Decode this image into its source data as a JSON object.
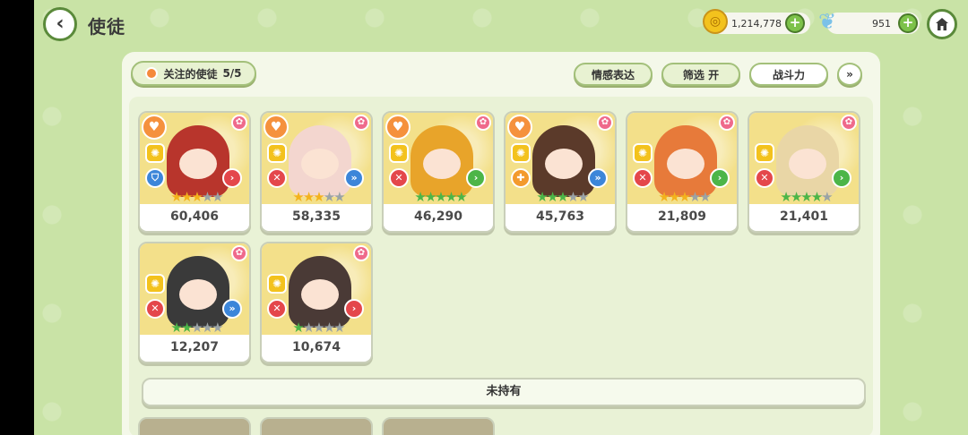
{
  "header": {
    "title": "使徒",
    "coins": "1,214,778",
    "gems": "951"
  },
  "toolbar": {
    "favorite_label": "关注的使徒",
    "favorite_count": "5/5",
    "emotion_label": "情感表达",
    "filter_label": "筛选 开",
    "power_label": "战斗力"
  },
  "cards": [
    {
      "power": "60,406",
      "favorite": true,
      "stars_filled": 3,
      "stars_total": 5,
      "star_color": "gold",
      "role": "blue",
      "arrow": "red",
      "hair": "#b8352c",
      "char": "red-haired demon girl"
    },
    {
      "power": "58,335",
      "favorite": true,
      "stars_filled": 3,
      "stars_total": 5,
      "star_color": "gold",
      "role": "red",
      "arrow": "blue",
      "hair": "#f3d6cf",
      "char": "pink-haired horned girl"
    },
    {
      "power": "46,290",
      "favorite": true,
      "stars_filled": 5,
      "stars_total": 5,
      "star_color": "green",
      "role": "red",
      "arrow": "green",
      "hair": "#e8a42a",
      "char": "bee"
    },
    {
      "power": "45,763",
      "favorite": true,
      "stars_filled": 3,
      "stars_total": 5,
      "star_color": "green",
      "role": "orange",
      "arrow": "blue",
      "hair": "#5b3a2a",
      "char": "brown-haired girl"
    },
    {
      "power": "21,809",
      "favorite": false,
      "stars_filled": 3,
      "stars_total": 5,
      "star_color": "gold",
      "role": "red",
      "arrow": "green",
      "hair": "#e77a3a",
      "char": "fox girl"
    },
    {
      "power": "21,401",
      "favorite": false,
      "stars_filled": 4,
      "stars_total": 5,
      "star_color": "green",
      "role": "red",
      "arrow": "green",
      "hair": "#e9d6a6",
      "char": "blonde girl"
    },
    {
      "power": "12,207",
      "favorite": false,
      "stars_filled": 2,
      "stars_total": 5,
      "star_color": "green",
      "role": "red",
      "arrow": "blue",
      "hair": "#3a3a3a",
      "char": "helmet soldier"
    },
    {
      "power": "10,674",
      "favorite": false,
      "stars_filled": 1,
      "stars_total": 5,
      "star_color": "green",
      "role": "red",
      "arrow": "red",
      "hair": "#4a3a36",
      "char": "cat-eared dark girl"
    }
  ],
  "not_owned_label": "未持有"
}
